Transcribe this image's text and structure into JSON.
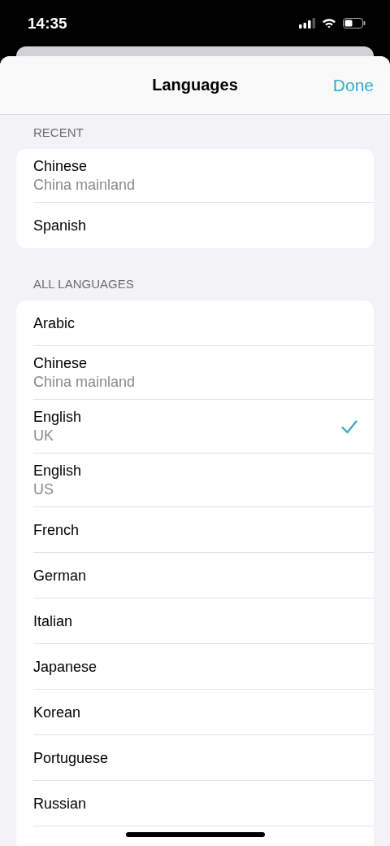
{
  "status_bar": {
    "time": "14:35"
  },
  "header": {
    "title": "Languages",
    "done": "Done"
  },
  "sections": [
    {
      "title": "RECENT",
      "items": [
        {
          "name": "Chinese",
          "region": "China mainland",
          "selected": false
        },
        {
          "name": "Spanish",
          "selected": false
        }
      ]
    },
    {
      "title": "ALL LANGUAGES",
      "items": [
        {
          "name": "Arabic",
          "selected": false
        },
        {
          "name": "Chinese",
          "region": "China mainland",
          "selected": false
        },
        {
          "name": "English",
          "region": "UK",
          "selected": true
        },
        {
          "name": "English",
          "region": "US",
          "selected": false
        },
        {
          "name": "French",
          "selected": false
        },
        {
          "name": "German",
          "selected": false
        },
        {
          "name": "Italian",
          "selected": false
        },
        {
          "name": "Japanese",
          "selected": false
        },
        {
          "name": "Korean",
          "selected": false
        },
        {
          "name": "Portuguese",
          "selected": false
        },
        {
          "name": "Russian",
          "selected": false
        }
      ]
    }
  ]
}
